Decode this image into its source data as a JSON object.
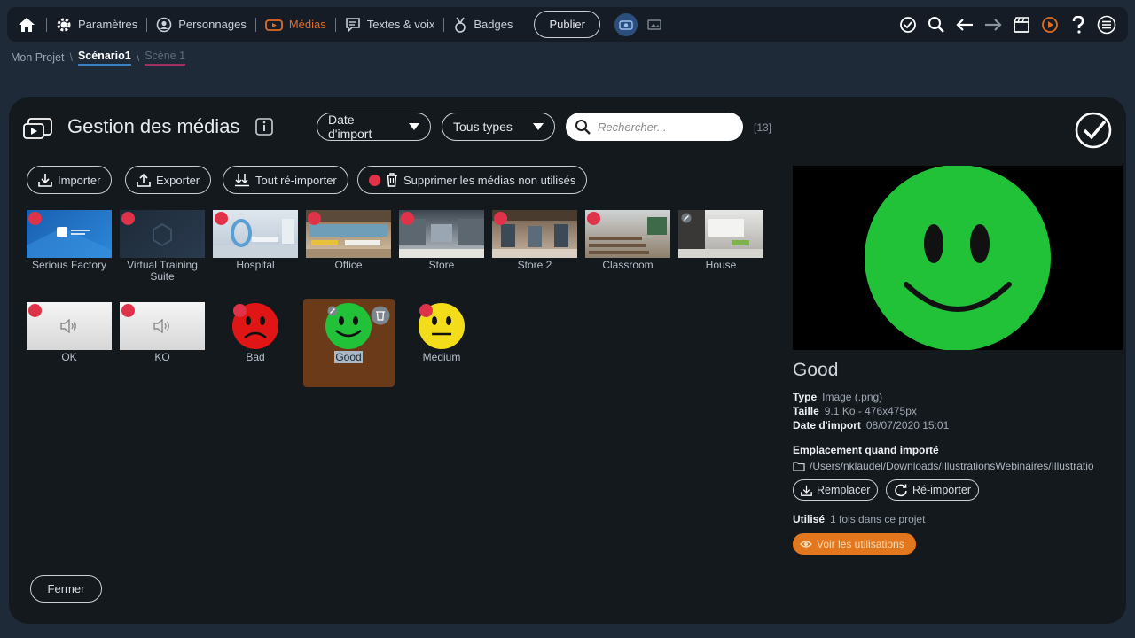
{
  "topbar": {
    "items": [
      {
        "label": "Paramètres",
        "icon": "gear-icon"
      },
      {
        "label": "Personnages",
        "icon": "character-icon"
      },
      {
        "label": "Médias",
        "icon": "media-icon",
        "active": true
      },
      {
        "label": "Textes & voix",
        "icon": "speech-icon"
      },
      {
        "label": "Badges",
        "icon": "badge-icon"
      }
    ],
    "publish_label": "Publier",
    "right_icons": [
      "check-circle-icon",
      "search-icon",
      "undo-arrow-icon",
      "redo-arrow-icon",
      "clapperboard-icon",
      "play-circle-icon",
      "help-icon",
      "menu-icon"
    ],
    "accent_color": "#e06b23"
  },
  "breadcrumb": {
    "project": "Mon Projet",
    "scenario": "Scénario1",
    "scene": "Scène 1"
  },
  "panel": {
    "title": "Gestion des médias",
    "sort_select": "Date d'import",
    "type_select": "Tous types",
    "search_placeholder": "Rechercher...",
    "count": "[13]",
    "actions": {
      "import": "Importer",
      "export": "Exporter",
      "reimport_all": "Tout ré-importer",
      "delete_unused": "Supprimer les médias non utilisés"
    },
    "close_label": "Fermer"
  },
  "media": [
    {
      "name": "Serious Factory",
      "kind": "image"
    },
    {
      "name": "Virtual Training Suite",
      "kind": "image"
    },
    {
      "name": "Hospital",
      "kind": "image"
    },
    {
      "name": "Office",
      "kind": "image"
    },
    {
      "name": "Store",
      "kind": "image"
    },
    {
      "name": "Store 2",
      "kind": "image"
    },
    {
      "name": "Classroom",
      "kind": "image"
    },
    {
      "name": "House",
      "kind": "image"
    },
    {
      "name": "OK",
      "kind": "sound"
    },
    {
      "name": "KO",
      "kind": "sound"
    },
    {
      "name": "Bad",
      "kind": "smiley-bad"
    },
    {
      "name": "Good",
      "kind": "smiley-good",
      "selected": true
    },
    {
      "name": "Medium",
      "kind": "smiley-medium"
    }
  ],
  "details": {
    "name": "Good",
    "type_label": "Type",
    "type_value": "Image (.png)",
    "size_label": "Taille",
    "size_value": "9.1 Ko - 476x475px",
    "date_label": "Date d'import",
    "date_value": "08/07/2020 15:01",
    "location_label": "Emplacement quand importé",
    "location_value": "/Users/nklaudel/Downloads/IllustrationsWebinaires/Illustratio",
    "replace_label": "Remplacer",
    "reimport_label": "Ré-importer",
    "used_label": "Utilisé",
    "used_value": "1 fois dans ce projet",
    "view_uses_label": "Voir les utilisations"
  }
}
